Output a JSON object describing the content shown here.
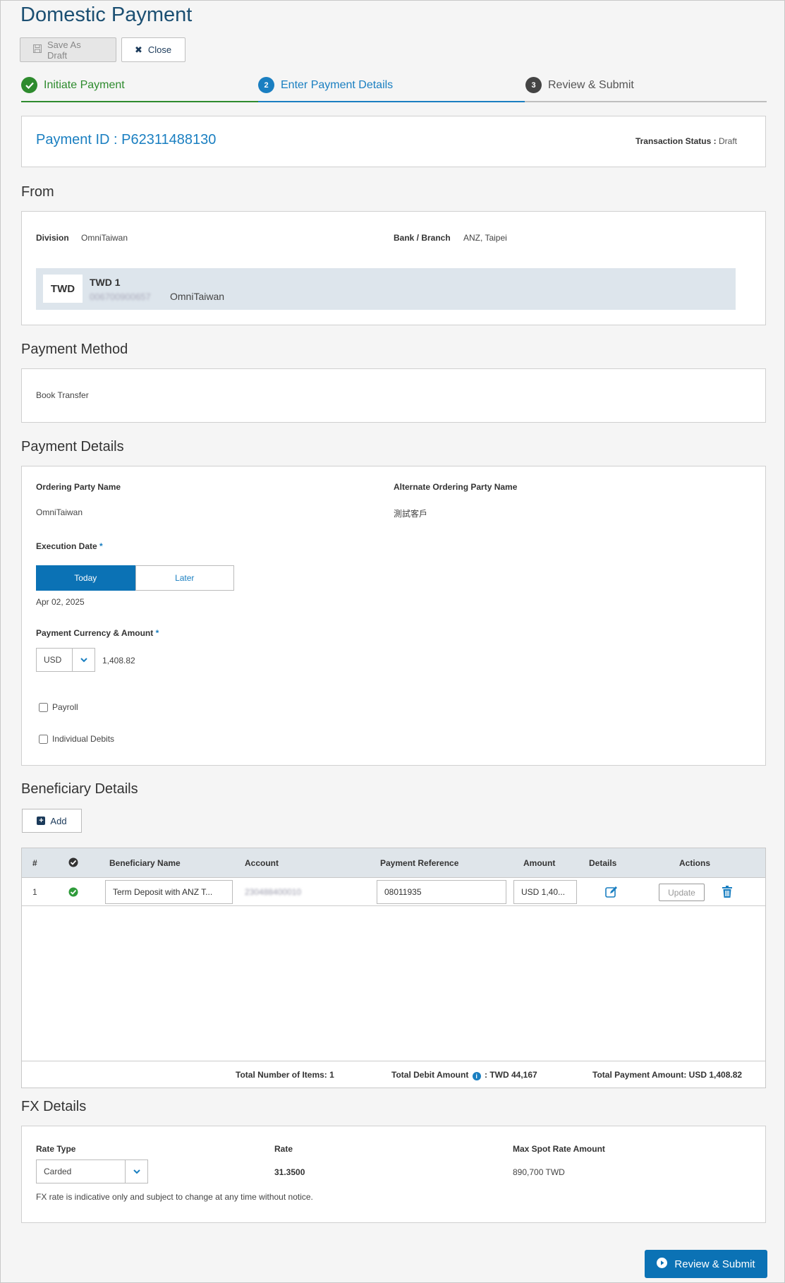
{
  "page": {
    "title": "Domestic Payment"
  },
  "toolbar": {
    "save_draft_label": "Save As Draft",
    "close_label": "Close"
  },
  "stepper": {
    "steps": [
      {
        "label": "Initiate Payment",
        "number": "",
        "state": "done"
      },
      {
        "label": "Enter Payment Details",
        "number": "2",
        "state": "active"
      },
      {
        "label": "Review & Submit",
        "number": "3",
        "state": "pending"
      }
    ]
  },
  "payment": {
    "id_label": "Payment ID : P62311488130",
    "status_label": "Transaction Status :",
    "status_value": "Draft"
  },
  "from": {
    "section_title": "From",
    "division_label": "Division",
    "division_value": "OmniTaiwan",
    "bank_label": "Bank / Branch",
    "bank_value": "ANZ, Taipei",
    "account": {
      "currency": "TWD",
      "name": "TWD 1",
      "number": "006700900657",
      "division": "OmniTaiwan"
    }
  },
  "method": {
    "section_title": "Payment Method",
    "value": "Book Transfer"
  },
  "details": {
    "section_title": "Payment Details",
    "ordering_label": "Ordering Party Name",
    "ordering_value": "OmniTaiwan",
    "alt_ordering_label": "Alternate Ordering Party Name",
    "alt_ordering_value": "測試客戶",
    "exec_date_label": "Execution Date",
    "required_mark": "*",
    "today_label": "Today",
    "later_label": "Later",
    "exec_date_value": "Apr 02, 2025",
    "currency_amount_label": "Payment Currency & Amount",
    "currency_value": "USD",
    "amount_value": "1,408.82",
    "payroll_label": "Payroll",
    "individual_debits_label": "Individual Debits"
  },
  "beneficiary": {
    "section_title": "Beneficiary Details",
    "add_label": "Add",
    "columns": {
      "num": "#",
      "name": "Beneficiary Name",
      "account": "Account",
      "reference": "Payment Reference",
      "amount": "Amount",
      "details": "Details",
      "actions": "Actions"
    },
    "rows": [
      {
        "num": "1",
        "name": "Term Deposit with ANZ T...",
        "account": "230488400010",
        "reference": "08011935",
        "amount": "USD 1,40...",
        "update_label": "Update"
      }
    ],
    "footer": {
      "total_items": "Total Number of Items: 1",
      "total_debit_label": "Total Debit Amount",
      "total_debit_value": ": TWD 44,167",
      "total_payment": "Total Payment Amount: USD 1,408.82"
    }
  },
  "fx": {
    "section_title": "FX Details",
    "rate_type_label": "Rate Type",
    "rate_type_value": "Carded",
    "rate_label": "Rate",
    "rate_value": "31.3500",
    "max_spot_label": "Max Spot Rate Amount",
    "max_spot_value": "890,700 TWD",
    "note": "FX rate is indicative only and subject to change at any time without notice."
  },
  "submit": {
    "review_label": "Review & Submit"
  },
  "colors": {
    "primary": "#0b72b5",
    "success": "#2e8b2e",
    "title": "#1b4f72"
  }
}
